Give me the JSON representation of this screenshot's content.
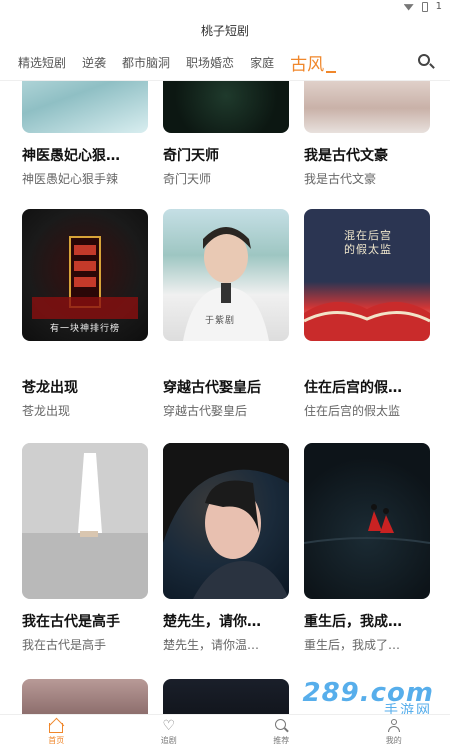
{
  "status_bar": {
    "signal_text": "1"
  },
  "app_title": "桃子短剧",
  "tabs": [
    {
      "label": "精选短剧"
    },
    {
      "label": "逆袭"
    },
    {
      "label": "都市脑洞"
    },
    {
      "label": "职场婚恋"
    },
    {
      "label": "家庭"
    },
    {
      "label": "古风",
      "active": true
    }
  ],
  "cards": [
    {
      "title": "神医愚妃心狠…",
      "subtitle": "神医愚妃心狠手辣"
    },
    {
      "title": "奇门天师",
      "subtitle": "奇门天师"
    },
    {
      "title": "我是古代文豪",
      "subtitle": "我是古代文豪"
    },
    {
      "title": "苍龙出现",
      "subtitle": "苍龙出现",
      "poster_text": "有一块神排行榜"
    },
    {
      "title": "穿越古代娶皇后",
      "subtitle": "穿越古代娶皇后",
      "poster_text": "于紫剧"
    },
    {
      "title": "住在后宫的假…",
      "subtitle": "住在后宫的假太监",
      "poster_text": "混在后宫的假太监"
    },
    {
      "title": "我在古代是高手",
      "subtitle": "我在古代是高手"
    },
    {
      "title": "楚先生，请你…",
      "subtitle": "楚先生，请你温…"
    },
    {
      "title": "重生后，我成…",
      "subtitle": "重生后，我成了…"
    }
  ],
  "bottom_nav": [
    {
      "label": "首页",
      "icon": "home-icon",
      "active": true
    },
    {
      "label": "追剧",
      "icon": "heart-icon"
    },
    {
      "label": "推荐",
      "icon": "search-icon"
    },
    {
      "label": "我的",
      "icon": "user-icon"
    }
  ],
  "watermark": {
    "main": "289.com",
    "sub": "手游网"
  },
  "colors": {
    "accent": "#f0872b",
    "text": "#111111",
    "subtext": "#666666"
  }
}
